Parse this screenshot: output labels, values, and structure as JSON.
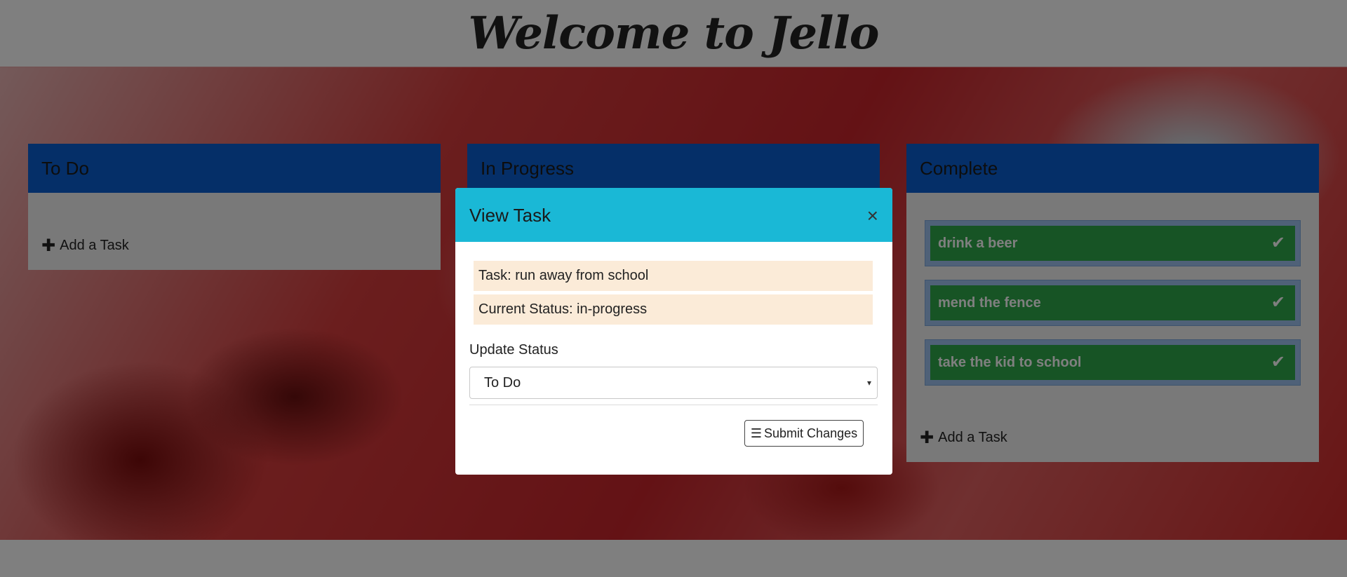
{
  "header": {
    "title": "Welcome to Jello"
  },
  "columns": {
    "todo": {
      "title": "To Do",
      "add_label": "Add a Task"
    },
    "in_progress": {
      "title": "In Progress"
    },
    "complete": {
      "title": "Complete",
      "add_label": "Add a Task",
      "cards": [
        "drink a beer",
        "mend the fence",
        "take the kid to school"
      ]
    }
  },
  "modal": {
    "title": "View Task",
    "close_icon": "×",
    "task_line": "Task: run away from school",
    "status_line": "Current Status: in-progress",
    "update_label": "Update Status",
    "select_value": "To Do",
    "submit_label": "Submit Changes"
  },
  "icons": {
    "plus": "✚",
    "check": "✔",
    "list": "☰",
    "caret": "▾"
  },
  "colors": {
    "column_header": "#0a5fd0",
    "card": "#2ea84a",
    "modal_header": "#1ab8d6",
    "info_row": "#fbebd8"
  }
}
